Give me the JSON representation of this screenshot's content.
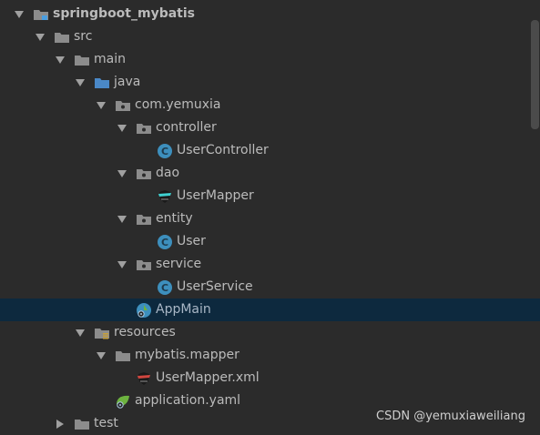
{
  "tree": {
    "project": "springboot_mybatis",
    "src": "src",
    "main": "main",
    "java": "java",
    "package": "com.yemuxia",
    "controller": "controller",
    "user_controller": "UserController",
    "dao": "dao",
    "user_mapper": "UserMapper",
    "entity": "entity",
    "user": "User",
    "service": "service",
    "user_service": "UserService",
    "app_main": "AppMain",
    "resources": "resources",
    "mybatis_mapper": "mybatis.mapper",
    "user_mapper_xml": "UserMapper.xml",
    "application_yaml": "application.yaml",
    "test": "test"
  },
  "watermark": "CSDN @yemuxiaweiliang",
  "colors": {
    "background": "#2b2b2b",
    "selection": "#0d293e",
    "class_icon": "#3d8fbd",
    "folder": "#8c8c8c",
    "source_folder": "#4a88c7"
  }
}
